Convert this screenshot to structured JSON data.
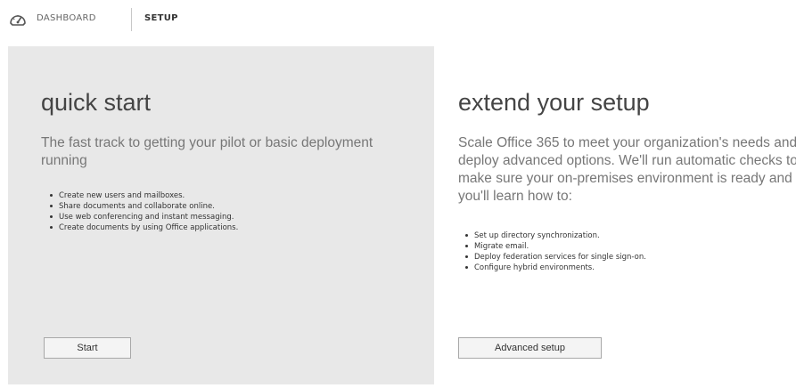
{
  "nav": {
    "dashboard_label": "DASHBOARD",
    "setup_label": "SETUP",
    "logo_icon": "speedometer-icon"
  },
  "quick_start": {
    "title": "quick start",
    "lead": "The fast track to getting your pilot or basic deployment running",
    "bullets": [
      "Create new users and mailboxes.",
      "Share documents and collaborate online.",
      "Use web conferencing and instant messaging.",
      "Create documents by using Office applications."
    ],
    "button_label": "Start"
  },
  "extend_setup": {
    "title": "extend your setup",
    "lead": "Scale Office 365 to meet your organization's needs and deploy advanced options. We'll run automatic checks to make sure your on-premises environment is ready and you'll learn how to:",
    "bullets": [
      "Set up directory synchronization.",
      "Migrate email.",
      "Deploy federation services for single sign-on.",
      "Configure hybrid environments."
    ],
    "button_label": "Advanced setup"
  },
  "colors": {
    "left_panel_bg": "#e8e8e8",
    "heading": "#444444",
    "lead": "#777777"
  }
}
